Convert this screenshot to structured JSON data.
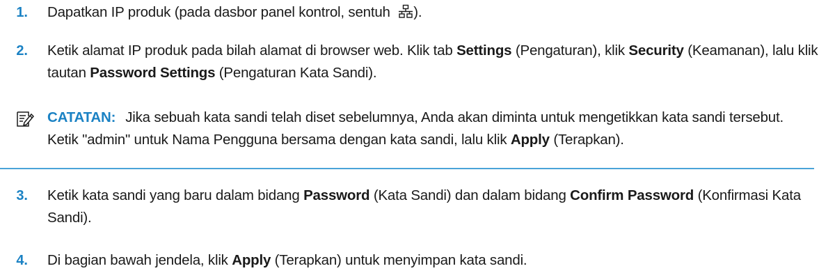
{
  "steps": [
    {
      "number": "1.",
      "before_icon": "Dapatkan IP produk (pada dasbor panel kontrol, sentuh ",
      "icon": "network-icon",
      "after_icon": ")."
    },
    {
      "number": "2.",
      "t1": "Ketik alamat IP produk pada bilah alamat di browser web. Klik tab ",
      "b1": "Settings",
      "t2": " (Pengaturan), klik ",
      "b2": "Security",
      "t3": " (Keamanan), lalu klik tautan ",
      "b3": "Password Settings",
      "t4": " (Pengaturan Kata Sandi)."
    },
    {
      "number": "3.",
      "t1": "Ketik kata sandi yang baru dalam bidang ",
      "b1": "Password",
      "t2": " (Kata Sandi) dan dalam bidang ",
      "b2": "Confirm Password",
      "t3": " (Konfirmasi Kata Sandi)."
    },
    {
      "number": "4.",
      "t1": "Di bagian bawah jendela, klik ",
      "b1": "Apply",
      "t2": " (Terapkan) untuk menyimpan kata sandi."
    }
  ],
  "note": {
    "icon": "note-pencil-icon",
    "label": "CATATAN:",
    "t1": "Jika sebuah kata sandi telah diset sebelumnya, Anda akan diminta untuk mengetikkan kata sandi tersebut. Ketik \"admin\" untuk Nama Pengguna bersama dengan kata sandi, lalu klik ",
    "b1": "Apply",
    "t2": " (Terapkan)."
  },
  "colors": {
    "accent": "#1b82c4",
    "rule": "#4aa3d8",
    "text": "#1a1a1a"
  }
}
